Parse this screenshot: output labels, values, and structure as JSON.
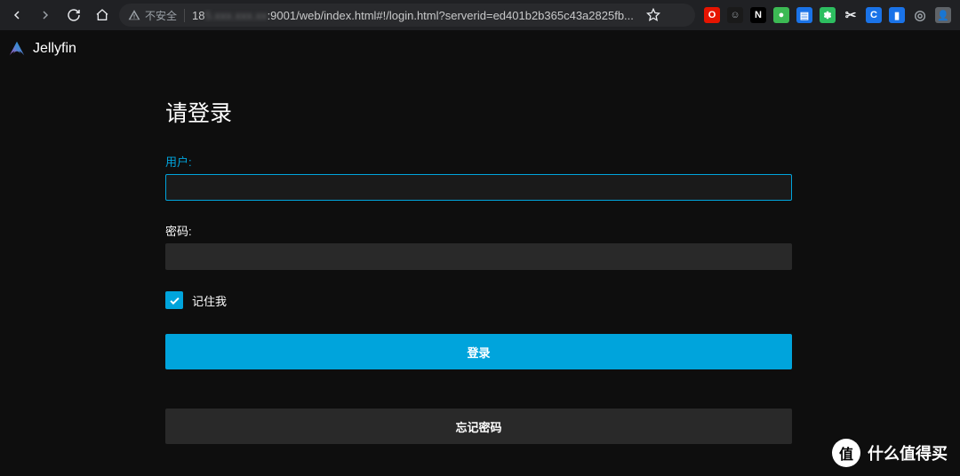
{
  "browser": {
    "not_secure_label": "不安全",
    "url_prefix": "18",
    "url_blur_segment": "5.xxx.xxx.xx",
    "url_suffix": ":9001/web/index.html#!/login.html?serverid=ed401b2b365c43a2825fb...",
    "extensions": [
      {
        "name": "ext-o",
        "bg": "#e61400",
        "fg": "#ffffff",
        "glyph": "O"
      },
      {
        "name": "ext-face",
        "bg": "#1a1a1a",
        "fg": "#9aa0a6",
        "glyph": "☺"
      },
      {
        "name": "ext-n1",
        "bg": "#000000",
        "fg": "#ffffff",
        "glyph": "N"
      },
      {
        "name": "ext-green",
        "bg": "#3cba54",
        "fg": "#ffffff",
        "glyph": "●"
      },
      {
        "name": "ext-doc",
        "bg": "#1a73e8",
        "fg": "#ffffff",
        "glyph": "▤"
      },
      {
        "name": "ext-evernote",
        "bg": "#2dbe60",
        "fg": "#ffffff",
        "glyph": "✽"
      },
      {
        "name": "ext-cut",
        "bg": "transparent",
        "fg": "#e8eaed",
        "glyph": "✂"
      },
      {
        "name": "ext-c",
        "bg": "#1a73e8",
        "fg": "#ffffff",
        "glyph": "C"
      },
      {
        "name": "ext-n2",
        "bg": "#1a73e8",
        "fg": "#ffffff",
        "glyph": "▮"
      },
      {
        "name": "ext-target",
        "bg": "transparent",
        "fg": "#9aa0a6",
        "glyph": "◎"
      },
      {
        "name": "ext-avatar",
        "bg": "#5f6368",
        "fg": "#ffffff",
        "glyph": "👤"
      }
    ]
  },
  "app": {
    "brand": "Jellyfin"
  },
  "login": {
    "title": "请登录",
    "user_label": "用户:",
    "user_value": "",
    "password_label": "密码:",
    "password_value": "",
    "remember_label": "记住我",
    "remember_checked": true,
    "submit_label": "登录",
    "forgot_label": "忘记密码"
  },
  "watermark": {
    "badge": "值",
    "text": "什么值得买"
  },
  "colors": {
    "accent": "#00a4dc",
    "bg": "#0e0e0e",
    "input_bg": "#292929"
  }
}
